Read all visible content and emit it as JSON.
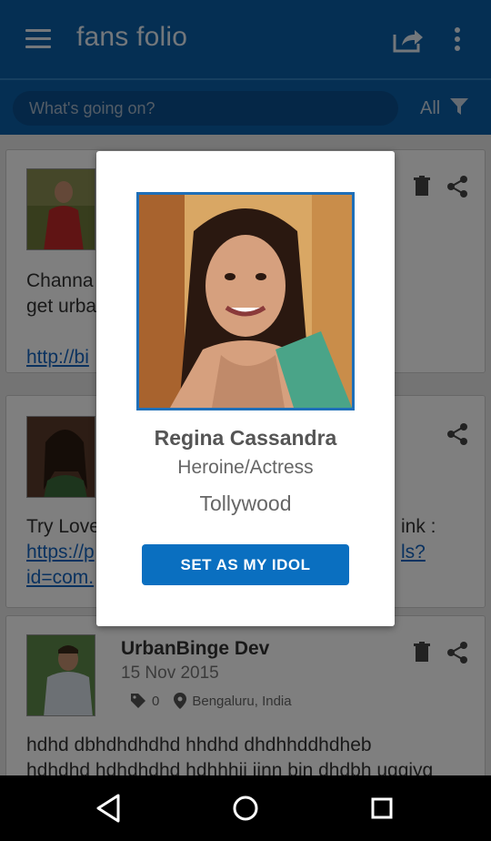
{
  "app": {
    "title": "fans folio"
  },
  "search": {
    "placeholder": "What's going on?",
    "filter_label": "All"
  },
  "feed": {
    "card1": {
      "body_text": "Channa",
      "body_text2": "get urba",
      "link_text": "http://bi"
    },
    "card2": {
      "body_text": "Try Love",
      "body_text_right": "ink :",
      "link_text": "https://p",
      "link_text_right": "ls?",
      "link_text2": "id=com."
    },
    "card3": {
      "author": "UrbanBinge Dev",
      "date": "15 Nov 2015",
      "tag_count": "0",
      "location": "Bengaluru, India",
      "body_text": "hdhd dbhdhdhdhd hhdhd dhdhhddhdheb",
      "body_text2": "hdhdhd hdhdhdhd hdhhhii jinn bin dhdbh uggiyg"
    }
  },
  "dialog": {
    "name": "Regina Cassandra",
    "role": "Heroine/Actress",
    "industry": "Tollywood",
    "cta_label": "SET AS MY IDOL"
  },
  "colors": {
    "primary": "#0a5fa6",
    "accent": "#0a6fc0",
    "link": "#1565c0"
  }
}
